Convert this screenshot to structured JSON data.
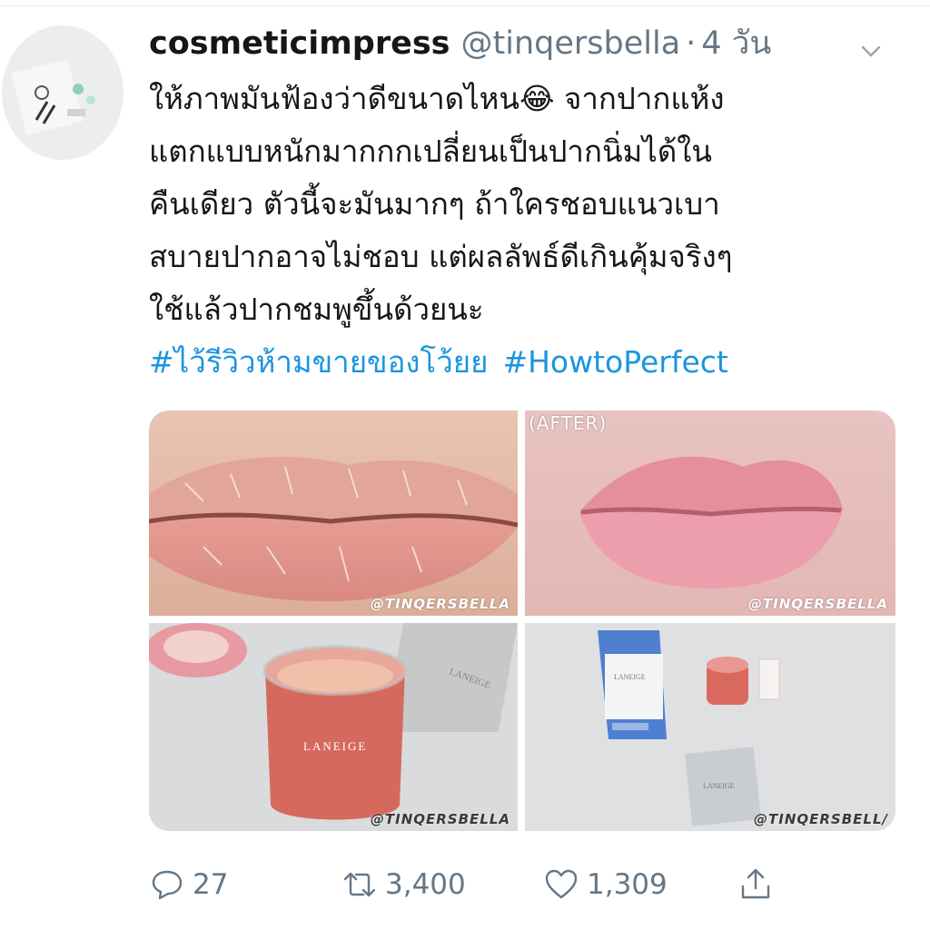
{
  "tweet": {
    "username": "cosmeticimpress",
    "handle": "@tinqersbella",
    "separator": "·",
    "time": "4 วัน",
    "text_lines": [
      "ให้ภาพมันฟ้องว่าดีขนาดไหน😂 จากปากแห้ง",
      "แตกแบบหนักมากกกเปลี่ยนเป็นปากนิ่มได้ใน",
      "คืนเดียว ตัวนี้จะมันมากๆ ถ้าใครชอบแนวเบา",
      "สบายปากอาจไม่ชอบ แต่ผลลัพธ์ดีเกินคุ้มจริงๆ",
      "ใช้แล้วปากชมพูขึ้นด้วยนะ"
    ],
    "hashtags": [
      "#ไว้รีวิวห้ามขายของโว้ยย",
      "#HowtoPerfect"
    ]
  },
  "media": {
    "before_watermark": "@TINQERSBELLA",
    "after_label": "(AFTER)",
    "after_watermark": "@TINQERSBELLA",
    "jar_watermark": "@TINQERSBELLA",
    "box_watermark": "@TINQERSBELL/",
    "product_text": "LANEIGE"
  },
  "actions": {
    "reply_count": "27",
    "retweet_count": "3,400",
    "like_count": "1,309"
  },
  "icons": {
    "reply": "reply-icon",
    "retweet": "retweet-icon",
    "like": "heart-icon",
    "share": "share-icon",
    "more": "chevron-down-icon"
  },
  "colors": {
    "hashtag": "#1b95e0",
    "secondary_text": "#657786",
    "primary_text": "#14171a"
  }
}
